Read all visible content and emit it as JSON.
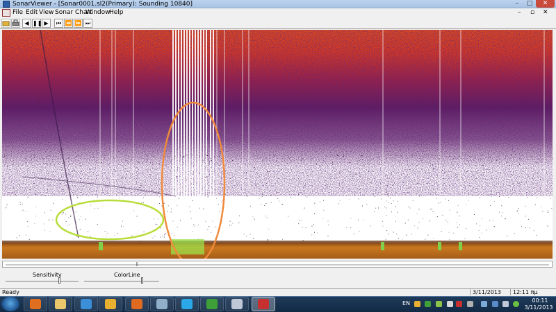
{
  "window": {
    "title": "SonarViewer - [Sonar0001.sl2(Primary): Sounding 10840]",
    "controls": {
      "minimize": "–",
      "maximize": "□",
      "close": "✕"
    }
  },
  "menu": {
    "items": [
      "File",
      "Edit",
      "View",
      "Sonar Chart",
      "Window",
      "Help"
    ],
    "mdi_controls": {
      "minimize": "–",
      "restore": "▫",
      "close": "✕"
    }
  },
  "toolbar": {
    "buttons": [
      {
        "name": "open-file-icon",
        "glyph": ""
      },
      {
        "name": "print-icon",
        "glyph": ""
      },
      {
        "name": "step-back-button",
        "glyph": "◀"
      },
      {
        "name": "pause-button",
        "glyph": "❚❚"
      },
      {
        "name": "play-button",
        "glyph": "▶"
      },
      {
        "name": "first-button",
        "glyph": "⏮"
      },
      {
        "name": "rewind-button",
        "glyph": "⏪"
      },
      {
        "name": "fast-forward-button",
        "glyph": "⏩"
      },
      {
        "name": "last-button",
        "glyph": "⏭"
      }
    ]
  },
  "sonar": {
    "colors": {
      "surface": "#e8531c",
      "mid": "#5a1a5e",
      "clutter": "#2a0a3a",
      "bottom": "#b4671e",
      "fish_highlight": "#9be04a",
      "annotation_green": "#b8dd3a",
      "annotation_orange": "#f08a3c"
    }
  },
  "sliders": {
    "sensitivity": {
      "label": "Sensitivity",
      "level": 0.74
    },
    "colorline": {
      "label": "ColorLine",
      "level": 0.78
    }
  },
  "status": {
    "text": "Ready",
    "date": "3/11/2013",
    "time": "12:11 πμ"
  },
  "taskbar": {
    "language": "EN",
    "clock_time": "00:11",
    "clock_date": "3/11/2013",
    "apps": [
      {
        "name": "media-player-icon",
        "color": "#e07020"
      },
      {
        "name": "file-explorer-icon",
        "color": "#e9c76a"
      },
      {
        "name": "internet-explorer-icon",
        "color": "#3a8fd8"
      },
      {
        "name": "network-app-icon",
        "color": "#e8b030"
      },
      {
        "name": "firefox-icon",
        "color": "#e06a20"
      },
      {
        "name": "weather-app-icon",
        "color": "#8fb0c8"
      },
      {
        "name": "skype-icon",
        "color": "#2aa8e8"
      },
      {
        "name": "utorrent-icon",
        "color": "#3fa03a"
      },
      {
        "name": "paint-icon",
        "color": "#c0c8d8"
      },
      {
        "name": "sonarviewer-icon",
        "color": "#c83030"
      }
    ]
  }
}
